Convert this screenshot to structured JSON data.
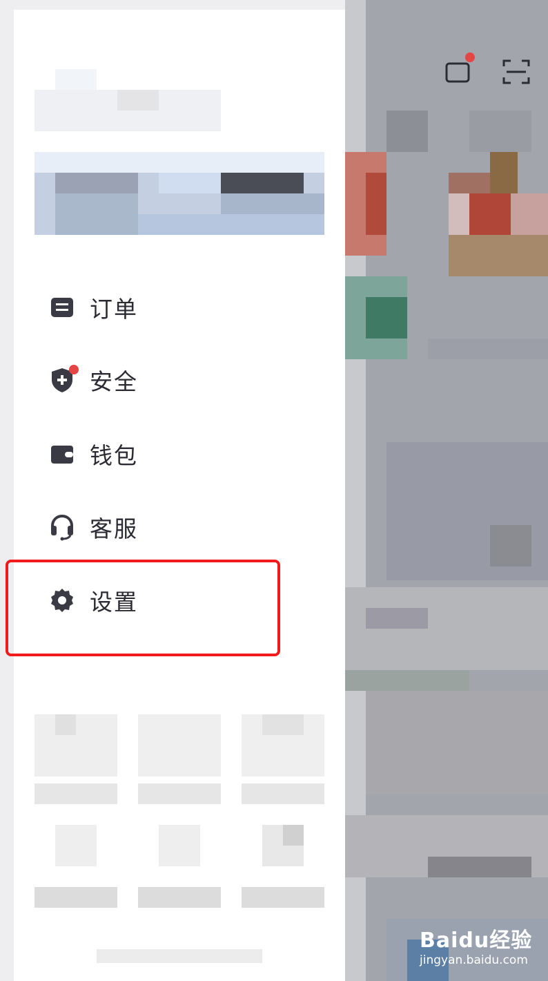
{
  "menu": {
    "items": [
      {
        "label": "订单",
        "icon": "order-icon"
      },
      {
        "label": "安全",
        "icon": "shield-plus-icon",
        "badge": true
      },
      {
        "label": "钱包",
        "icon": "wallet-icon"
      },
      {
        "label": "客服",
        "icon": "headset-icon"
      },
      {
        "label": "设置",
        "icon": "gear-icon",
        "highlighted": true
      }
    ]
  },
  "watermark": {
    "logo": "Baidu经验",
    "url": "jingyan.baidu.com"
  },
  "colors": {
    "highlight": "#f21b1b",
    "badge": "#e64545",
    "icon": "#3a3a44",
    "backdrop": "#a4a6ae"
  }
}
